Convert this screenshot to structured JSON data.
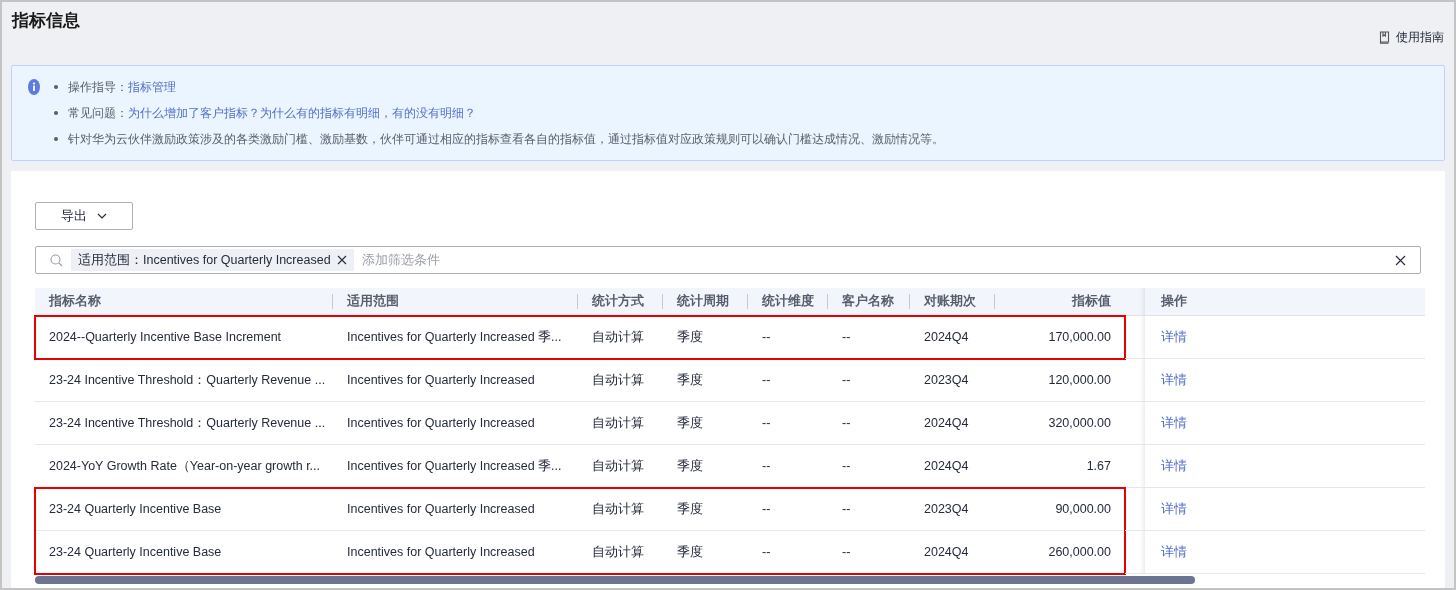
{
  "page_title": "指标信息",
  "guide_link": "使用指南",
  "notice": {
    "items": [
      {
        "label": "操作指导：",
        "links": [
          "指标管理"
        ]
      },
      {
        "label": "常见问题：",
        "links": [
          "为什么增加了客户指标？为什么有的指标有明细，有的没有明细？"
        ]
      },
      {
        "label": "针对华为云伙伴激励政策涉及的各类激励门槛、激励基数，伙伴可通过相应的指标查看各自的指标值，通过指标值对应政策规则可以确认门槛达成情况、激励情况等。"
      }
    ]
  },
  "export_button": "导出",
  "filter": {
    "chips": [
      "适用范围：Incentives for Quarterly Increased"
    ],
    "placeholder": "添加筛选条件"
  },
  "table": {
    "columns": [
      "指标名称",
      "适用范围",
      "统计方式",
      "统计周期",
      "统计维度",
      "客户名称",
      "对账期次",
      "指标值",
      "操作"
    ],
    "rows": [
      {
        "highlighted": true,
        "cells": [
          "2024--Quarterly Incentive Base Increment",
          "Incentives for Quarterly Increased 季...",
          "自动计算",
          "季度",
          "--",
          "--",
          "2024Q4",
          "170,000.00",
          "详情"
        ]
      },
      {
        "highlighted": false,
        "cells": [
          "23-24 Incentive Threshold：Quarterly Revenue ...",
          "Incentives for Quarterly Increased",
          "自动计算",
          "季度",
          "--",
          "--",
          "2023Q4",
          "120,000.00",
          "详情"
        ]
      },
      {
        "highlighted": false,
        "cells": [
          "23-24 Incentive Threshold：Quarterly Revenue ...",
          "Incentives for Quarterly Increased",
          "自动计算",
          "季度",
          "--",
          "--",
          "2024Q4",
          "320,000.00",
          "详情"
        ]
      },
      {
        "highlighted": false,
        "cells": [
          "2024-YoY Growth Rate（Year-on-year growth r...",
          "Incentives for Quarterly Increased 季...",
          "自动计算",
          "季度",
          "--",
          "--",
          "2024Q4",
          "1.67",
          "详情"
        ]
      },
      {
        "highlighted": true,
        "cells": [
          "23-24 Quarterly Incentive Base",
          "Incentives for Quarterly Increased",
          "自动计算",
          "季度",
          "--",
          "--",
          "2023Q4",
          "90,000.00",
          "详情"
        ]
      },
      {
        "highlighted": true,
        "cells": [
          "23-24 Quarterly Incentive Base",
          "Incentives for Quarterly Increased",
          "自动计算",
          "季度",
          "--",
          "--",
          "2024Q4",
          "260,000.00",
          "详情"
        ]
      }
    ]
  }
}
